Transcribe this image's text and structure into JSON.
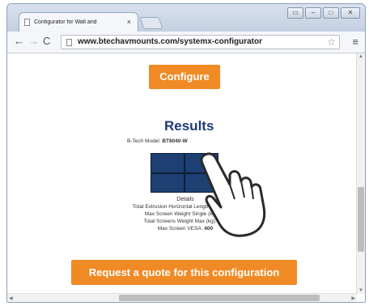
{
  "browser": {
    "tab_title": "Configurator for Wall and",
    "tab_close": "×",
    "url": "www.btechavmounts.com/systemx-configurator",
    "back_icon": "←",
    "forward_icon": "→",
    "reload_icon": "C",
    "star_icon": "☆",
    "menu_icon": "≡",
    "window_controls": [
      "▭",
      "–",
      "□",
      "✕"
    ]
  },
  "page": {
    "configure_label": "Configure",
    "results_title": "Results",
    "model_label": "B-Tech Model:",
    "model_value": "BT8040-W",
    "details": {
      "title": "Details",
      "lines": [
        {
          "label": "Total Extrusion Horizontal Length (mm):",
          "value": "1750"
        },
        {
          "label": "Max Screen Weight Single (kg):",
          "value": "30"
        },
        {
          "label": "Total Screens Weight Max (kg):",
          "value": "120"
        },
        {
          "label": "Max Screen VESA:",
          "value": "400"
        }
      ]
    },
    "quote_label": "Request a quote for this configuration"
  },
  "colors": {
    "accent": "#f08a24",
    "results_title": "#1e3a78",
    "screen_panel": "#1e3f72"
  },
  "icons": [
    "page-icon",
    "close-icon",
    "back-icon",
    "forward-icon",
    "reload-icon",
    "star-icon",
    "menu-icon",
    "hand-pointer-icon"
  ]
}
